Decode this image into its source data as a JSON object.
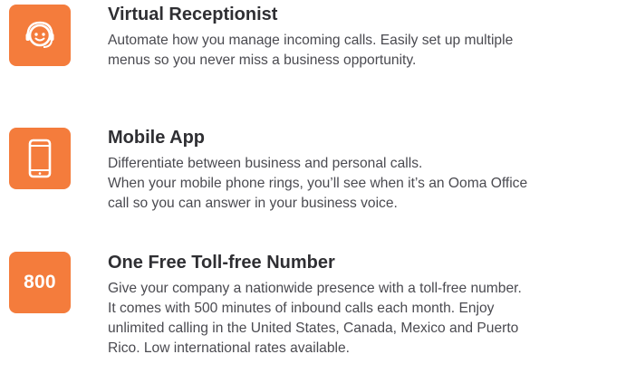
{
  "colors": {
    "accent": "#f47c3c",
    "title": "#2f2f33",
    "body": "#4a4a50",
    "background": "#ffffff"
  },
  "features": [
    {
      "icon": "headset-icon",
      "title": "Virtual Receptionist",
      "lines": [
        "Automate how you manage incoming calls. Easily set up multiple",
        "menus so you never miss a business opportunity."
      ]
    },
    {
      "icon": "mobile-phone-icon",
      "title": "Mobile App",
      "lines": [
        "Differentiate between business and personal calls.",
        "When your mobile phone rings, you’ll see when it’s an Ooma Office",
        "call so you can answer in your business voice."
      ]
    },
    {
      "icon": "toll-free-800-icon",
      "icon_text": "800",
      "title": "One Free Toll-free Number",
      "lines": [
        "Give your company a nationwide presence with a toll-free number.",
        "It comes with 500 minutes of inbound calls each month. Enjoy",
        "unlimited calling in the United States, Canada, Mexico and Puerto",
        "Rico. Low international rates available."
      ]
    }
  ]
}
